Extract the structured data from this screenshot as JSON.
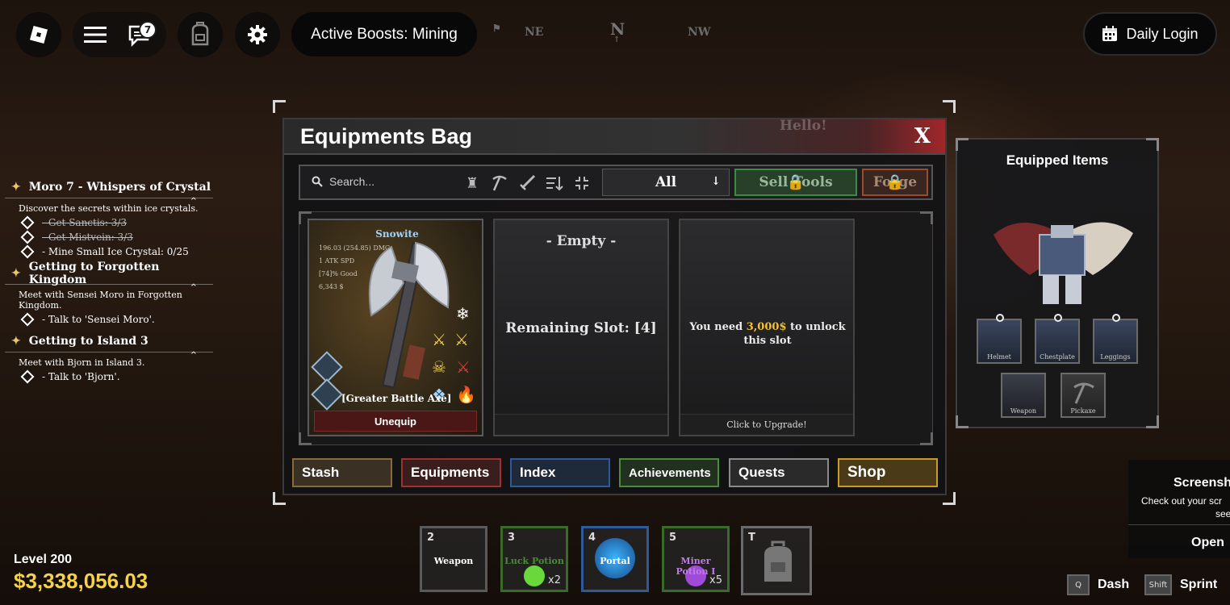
{
  "topbar": {
    "chat_badge": "7",
    "boosts_label": "Active Boosts: Mining",
    "daily_login": "Daily Login",
    "compass": {
      "ne": "NE",
      "n": "N",
      "nw": "NW"
    }
  },
  "quests": [
    {
      "title": "Moro 7 - Whispers of Crystal",
      "desc": "Discover the secrets within ice crystals.",
      "tasks": [
        {
          "text": "- Get Sanctis: 3/3",
          "done": true
        },
        {
          "text": "- Get Mistvein: 3/3",
          "done": true
        },
        {
          "text": "- Mine Small Ice Crystal: 0/25",
          "done": false
        }
      ]
    },
    {
      "title": "Getting to Forgotten Kingdom",
      "desc": "Meet with Sensei Moro in Forgotten Kingdom.",
      "tasks": [
        {
          "text": "- Talk to 'Sensei Moro'.",
          "done": false
        }
      ]
    },
    {
      "title": "Getting to Island 3",
      "desc": "Meet with Bjorn in Island 3.",
      "tasks": [
        {
          "text": "- Talk to 'Bjorn'.",
          "done": false
        }
      ]
    }
  ],
  "bag": {
    "title": "Equipments Bag",
    "close": "X",
    "hello": "Hello!",
    "search_placeholder": "Search...",
    "filter_value": "All",
    "sell_tools": "Sell Tools",
    "forge": "Forge",
    "equipped_slot": {
      "ore_name": "Snowite",
      "stats": [
        "196.03 (254.85) DMG",
        "1 ATK SPD",
        "[74]% Good",
        "6,343 $"
      ],
      "item_name": "[Greater Battle Axe]",
      "unequip": "Unequip"
    },
    "empty_slot": {
      "title": "- Empty -",
      "remaining": "Remaining Slot: [4]"
    },
    "locked_slot": {
      "need_pre": "You need ",
      "cost": "3,000$",
      "need_post": " to unlock this slot",
      "upgrade": "Click to Upgrade!"
    },
    "tabs": [
      {
        "label": "Stash",
        "color": "#8a6a3a"
      },
      {
        "label": "Equipments",
        "color": "#a03030"
      },
      {
        "label": "Index",
        "color": "#2f5a9a"
      },
      {
        "label": "Achievements",
        "color": "#4a8a3a"
      },
      {
        "label": "Quests",
        "color": "#8a8a8a"
      },
      {
        "label": "Shop",
        "color": "#c89a2a"
      }
    ]
  },
  "equipped": {
    "title": "Equipped Items",
    "slots": [
      "Helmet",
      "Chestplate",
      "Leggings",
      "Weapon",
      "Pickaxe"
    ]
  },
  "hotbar": [
    {
      "key": "2",
      "name": "Weapon",
      "qty": "",
      "color": "#6a6a6a"
    },
    {
      "key": "3",
      "name": "Luck Potion I",
      "qty": "x2",
      "color": "#4a7a2a"
    },
    {
      "key": "4",
      "name": "Portal",
      "qty": "",
      "color": "#2f5a9a"
    },
    {
      "key": "5",
      "name": "Miner Potion I",
      "qty": "x5",
      "color": "#4a7a2a"
    },
    {
      "key": "T",
      "name": "",
      "qty": "",
      "color": "#6a6a6a"
    }
  ],
  "player": {
    "level": "Level 200",
    "money": "$3,338,056.03"
  },
  "controls": {
    "dash_key": "Q",
    "dash": "Dash",
    "sprint_key": "Shift",
    "sprint": "Sprint"
  },
  "screenshot_panel": {
    "title": "Screensh",
    "text": "Check out your scr",
    "text2": "see",
    "open": "Open"
  }
}
